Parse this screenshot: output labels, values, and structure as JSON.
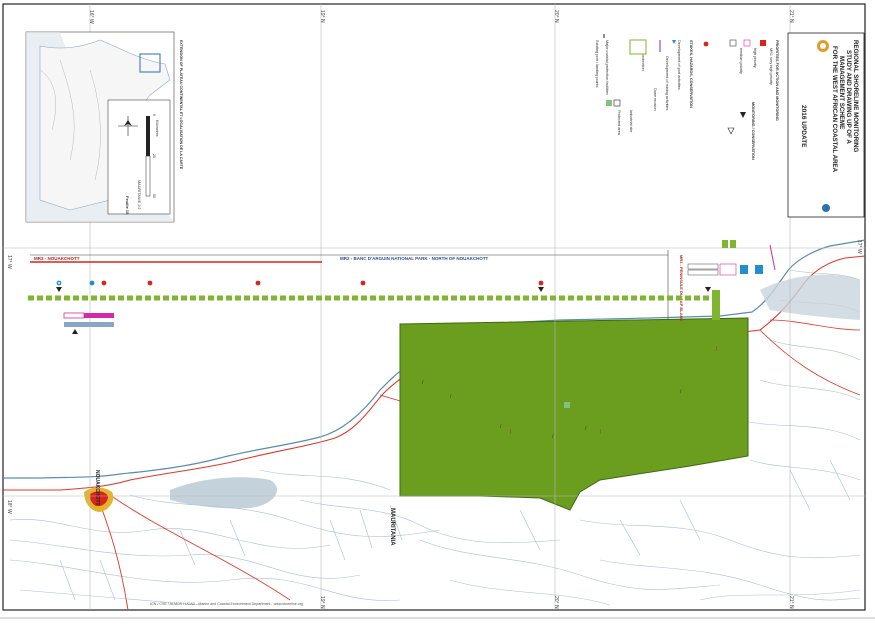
{
  "title_block": {
    "title_lines": [
      "REGIONAL SHORELINE MONITORING",
      "STUDY AND DRAWING UP OF A",
      "MANAGEMENT SCHEME",
      "FOR THE WEST AFRICAN COASTAL AREA"
    ],
    "update": "2016 UPDATE"
  },
  "graticule": {
    "top": [
      "16° W",
      "19° N",
      "20° N",
      "21° N"
    ],
    "left": [
      "17° W",
      "18° W"
    ],
    "right": [
      "17° W"
    ],
    "bottom": [
      "19° N",
      "20° N",
      "21° N"
    ]
  },
  "legend": {
    "heading_priorities": "PRIORITIES FOR ACTION AND MONITORING",
    "heading_monitoring": "MONITORING / CONSERVATION",
    "heading_stakes": "STAKES, HAZARDS, CONSERVATION",
    "priority_items": [
      "MR1 very high priority",
      "high priority",
      "medium priority"
    ],
    "items": [
      "Development of port activities",
      "Development of mining activities",
      "Dune erosion",
      "Coastal protection",
      "Industrial site",
      "Protected area",
      "Major coastal protection facilities",
      "Existing port / landing points"
    ]
  },
  "inset": {
    "caption": "EXTENSION OF PLATEAU CONTINENTAL ET LOCALISATION DE LA CARTE",
    "scale": "Kilometres",
    "scale_values": [
      "0",
      "25",
      "50"
    ],
    "sheet": "MAURITANIE 1/2",
    "sheet_no": "Feuille 15"
  },
  "sections": {
    "mr2": "MR2 - BANC D'ARGUIN NATIONAL PARK - NORTH OF NOUAKCHOTT",
    "mr3": "MR3 - NOUAKCHOTT",
    "mr1": "MR1 - PENINSULE DU CAP BLANC"
  },
  "places": {
    "city": "NOUAKCHOTT",
    "country": "MAURITANIA"
  },
  "credits": "IGN / CSE / ALMCS / UCAD - Marine and Coastal Environment Department - www.shoreline.org",
  "colors": {
    "park": "#6b9e1e",
    "park_edge": "#3e6a12",
    "water": "#aaccdd",
    "road": "#e0382b",
    "priority_red": "#d9231b",
    "priority_dash": "#7fb52f",
    "magenta": "#d42aa8",
    "band_blue": "#8aa6c6"
  }
}
